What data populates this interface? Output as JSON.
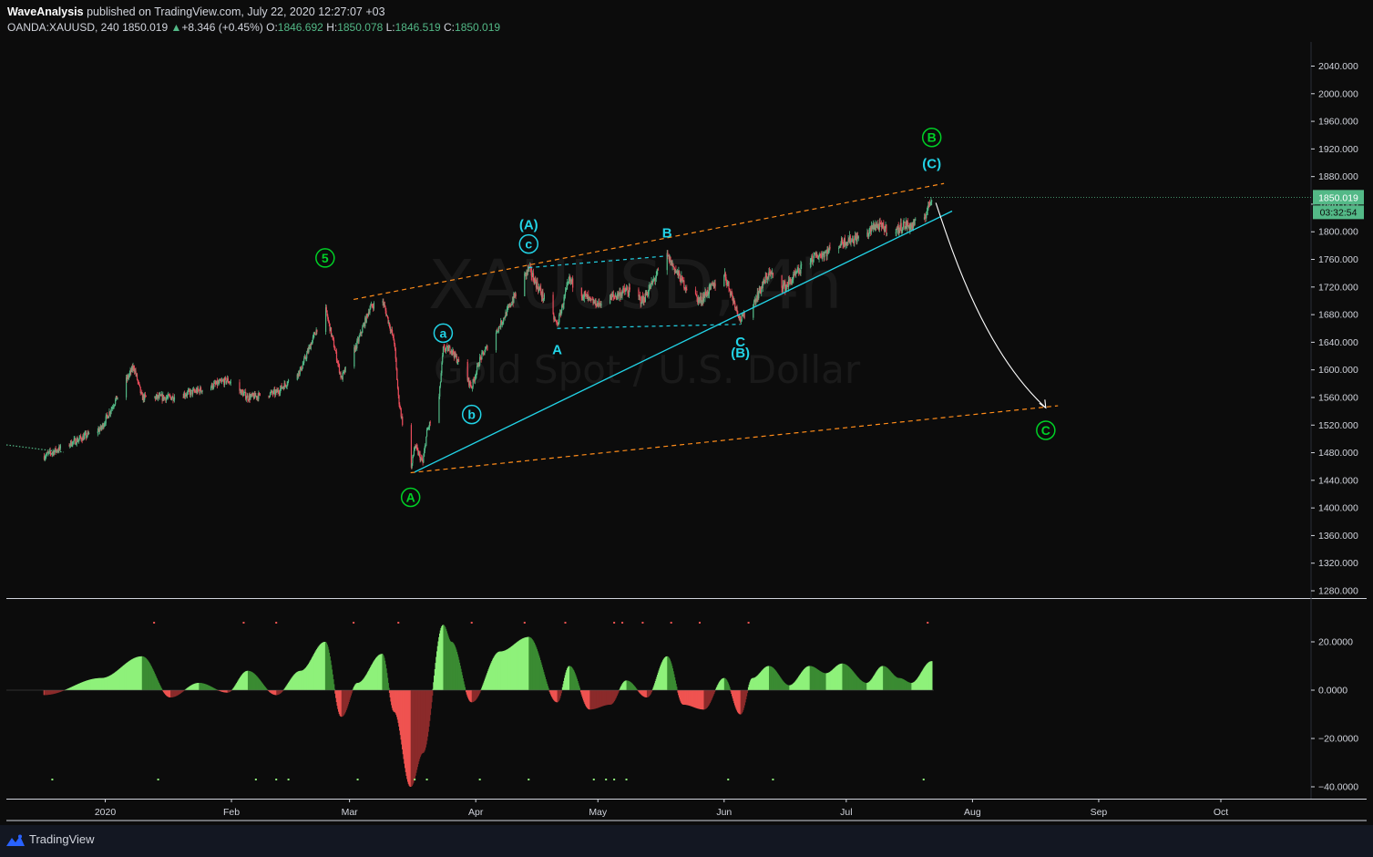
{
  "header": {
    "author": "WaveAnalysis",
    "published": "published on TradingView.com, July 22, 2020 12:27:07 +03",
    "symbol": "OANDA:XAUUSD, 240",
    "last": "1850.019",
    "change_arrow": "▲",
    "change": "+8.346 (+0.45%)",
    "o_label": "O:",
    "o_value": "1846.692",
    "h_label": "H:",
    "h_value": "1850.078",
    "l_label": "L:",
    "l_value": "1846.519",
    "c_label": "C:",
    "c_value": "1850.019"
  },
  "footer": {
    "brand": "TradingView",
    "logo_icon": "tradingview-logo-icon"
  },
  "colors": {
    "background": "#0c0c0c",
    "up": "#53b987",
    "down": "#eb4d5c",
    "wave_green": "#00d026",
    "wave_cyan": "#22d3e6",
    "channel_orange": "#ff8c1a",
    "osc_up_strong": "#8ef17a",
    "osc_up_weak": "#3a8b32",
    "osc_down_strong": "#ef5350",
    "osc_down_weak": "#8b2a2a"
  },
  "chart_data": [
    {
      "type": "candlestick",
      "title": "XAUUSD, 4h",
      "subtitle": "Gold Spot / U.S. Dollar",
      "watermark": "XAUUSD, 4h",
      "watermark_sub": "Gold Spot / U.S. Dollar",
      "price_label": "1850.019",
      "countdown": "03:32:54",
      "x_ticks": [
        "2020",
        "Feb",
        "Mar",
        "Apr",
        "May",
        "Jun",
        "Jul",
        "Aug",
        "Sep",
        "Oct"
      ],
      "y_ticks": [
        "2040.000",
        "2000.000",
        "1960.000",
        "1920.000",
        "1880.000",
        "1840.000",
        "1800.000",
        "1760.000",
        "1720.000",
        "1680.000",
        "1640.000",
        "1600.000",
        "1560.000",
        "1520.000",
        "1480.000",
        "1440.000",
        "1400.000",
        "1360.000",
        "1320.000",
        "1280.000"
      ],
      "ylim": [
        1280,
        2060
      ],
      "price_path": [
        [
          "2019-12-17",
          1475
        ],
        [
          "2019-12-24",
          1495
        ],
        [
          "2019-12-31",
          1515
        ],
        [
          "2020-01-03",
          1550
        ],
        [
          "2020-01-08",
          1605
        ],
        [
          "2020-01-10",
          1560
        ],
        [
          "2020-01-17",
          1560
        ],
        [
          "2020-01-24",
          1570
        ],
        [
          "2020-01-31",
          1585
        ],
        [
          "2020-02-05",
          1560
        ],
        [
          "2020-02-12",
          1567
        ],
        [
          "2020-02-18",
          1600
        ],
        [
          "2020-02-21",
          1645
        ],
        [
          "2020-02-24",
          1690
        ],
        [
          "2020-02-26",
          1640
        ],
        [
          "2020-02-28",
          1587
        ],
        [
          "2020-03-03",
          1640
        ],
        [
          "2020-03-06",
          1690
        ],
        [
          "2020-03-09",
          1703
        ],
        [
          "2020-03-12",
          1640
        ],
        [
          "2020-03-13",
          1560
        ],
        [
          "2020-03-16",
          1451
        ],
        [
          "2020-03-17",
          1490
        ],
        [
          "2020-03-19",
          1465
        ],
        [
          "2020-03-20",
          1510
        ],
        [
          "2020-03-23",
          1560
        ],
        [
          "2020-03-24",
          1630
        ],
        [
          "2020-03-26",
          1630
        ],
        [
          "2020-03-31",
          1575
        ],
        [
          "2020-04-02",
          1615
        ],
        [
          "2020-04-07",
          1665
        ],
        [
          "2020-04-14",
          1747
        ],
        [
          "2020-04-21",
          1665
        ],
        [
          "2020-04-24",
          1730
        ],
        [
          "2020-04-29",
          1700
        ],
        [
          "2020-05-01",
          1695
        ],
        [
          "2020-05-08",
          1715
        ],
        [
          "2020-05-12",
          1700
        ],
        [
          "2020-05-18",
          1765
        ],
        [
          "2020-05-22",
          1725
        ],
        [
          "2020-05-26",
          1700
        ],
        [
          "2020-06-01",
          1740
        ],
        [
          "2020-06-05",
          1672
        ],
        [
          "2020-06-08",
          1695
        ],
        [
          "2020-06-12",
          1740
        ],
        [
          "2020-06-16",
          1720
        ],
        [
          "2020-06-22",
          1760
        ],
        [
          "2020-06-26",
          1770
        ],
        [
          "2020-06-30",
          1785
        ],
        [
          "2020-07-06",
          1795
        ],
        [
          "2020-07-08",
          1810
        ],
        [
          "2020-07-13",
          1800
        ],
        [
          "2020-07-15",
          1810
        ],
        [
          "2020-07-17",
          1808
        ],
        [
          "2020-07-20",
          1818
        ],
        [
          "2020-07-22",
          1850
        ]
      ],
      "wave_labels": [
        {
          "text": "5",
          "style": "circled-green",
          "date": "2020-02-24"
        },
        {
          "text": "A",
          "style": "circled-green",
          "date": "2020-03-16"
        },
        {
          "text": "B",
          "style": "circled-green",
          "date": "2020-07-22"
        },
        {
          "text": "C",
          "style": "circled-green",
          "date": "2020-08-19"
        },
        {
          "text": "(A)",
          "style": "cyan",
          "date": "2020-04-14"
        },
        {
          "text": "(B)",
          "style": "cyan",
          "date": "2020-06-05"
        },
        {
          "text": "(C)",
          "style": "cyan",
          "date": "2020-07-22"
        },
        {
          "text": "a",
          "style": "circled-cyan",
          "date": "2020-03-24"
        },
        {
          "text": "b",
          "style": "circled-cyan",
          "date": "2020-03-31"
        },
        {
          "text": "c",
          "style": "circled-cyan",
          "date": "2020-04-14"
        },
        {
          "text": "A",
          "style": "cyan",
          "date": "2020-04-21"
        },
        {
          "text": "B",
          "style": "cyan",
          "date": "2020-05-18"
        },
        {
          "text": "C",
          "style": "cyan",
          "date": "2020-06-05"
        }
      ],
      "trendlines": [
        {
          "name": "channel-upper",
          "style": "orange-dashed",
          "from": [
            "2020-03-02",
            1702
          ],
          "to": [
            "2020-07-25",
            1870
          ]
        },
        {
          "name": "channel-lower",
          "style": "orange-dashed",
          "from": [
            "2020-03-16",
            1451
          ],
          "to": [
            "2020-08-22",
            1548
          ]
        },
        {
          "name": "support",
          "style": "cyan-solid",
          "from": [
            "2020-03-17",
            1452
          ],
          "to": [
            "2020-07-27",
            1830
          ]
        },
        {
          "name": "triangle-top",
          "style": "cyan-dashed",
          "from": [
            "2020-04-14",
            1748
          ],
          "to": [
            "2020-05-18",
            1765
          ]
        },
        {
          "name": "triangle-bottom",
          "style": "cyan-dashed",
          "from": [
            "2020-04-21",
            1660
          ],
          "to": [
            "2020-06-05",
            1666
          ]
        },
        {
          "name": "projection",
          "style": "white-arrow",
          "from": [
            "2020-07-23",
            1842
          ],
          "to": [
            "2020-08-19",
            1545
          ]
        }
      ]
    },
    {
      "type": "area",
      "name": "oscillator",
      "y_ticks": [
        "20.0000",
        "0.0000",
        "−20.0000",
        "−40.0000"
      ],
      "ylim": [
        -42,
        27
      ],
      "x_dates": [
        "2019-12-17",
        "2019-12-31",
        "2020-01-10",
        "2020-01-17",
        "2020-01-24",
        "2020-01-31",
        "2020-02-05",
        "2020-02-12",
        "2020-02-18",
        "2020-02-24",
        "2020-02-28",
        "2020-03-03",
        "2020-03-09",
        "2020-03-12",
        "2020-03-16",
        "2020-03-19",
        "2020-03-24",
        "2020-03-26",
        "2020-03-31",
        "2020-04-07",
        "2020-04-14",
        "2020-04-21",
        "2020-04-24",
        "2020-04-29",
        "2020-05-04",
        "2020-05-08",
        "2020-05-13",
        "2020-05-18",
        "2020-05-22",
        "2020-05-27",
        "2020-06-01",
        "2020-06-05",
        "2020-06-08",
        "2020-06-12",
        "2020-06-17",
        "2020-06-22",
        "2020-06-26",
        "2020-06-30",
        "2020-07-06",
        "2020-07-10",
        "2020-07-14",
        "2020-07-17",
        "2020-07-22"
      ],
      "values": [
        -2,
        5,
        14,
        -3,
        3,
        -1,
        8,
        -2,
        8,
        20,
        -11,
        3,
        15,
        -9,
        -40,
        -26,
        27,
        20,
        -5,
        16,
        22,
        -5,
        10,
        -8,
        -6,
        4,
        -3,
        14,
        -6,
        -8,
        5,
        -10,
        5,
        10,
        2,
        10,
        7,
        11,
        3,
        10,
        5,
        3,
        12
      ]
    }
  ]
}
